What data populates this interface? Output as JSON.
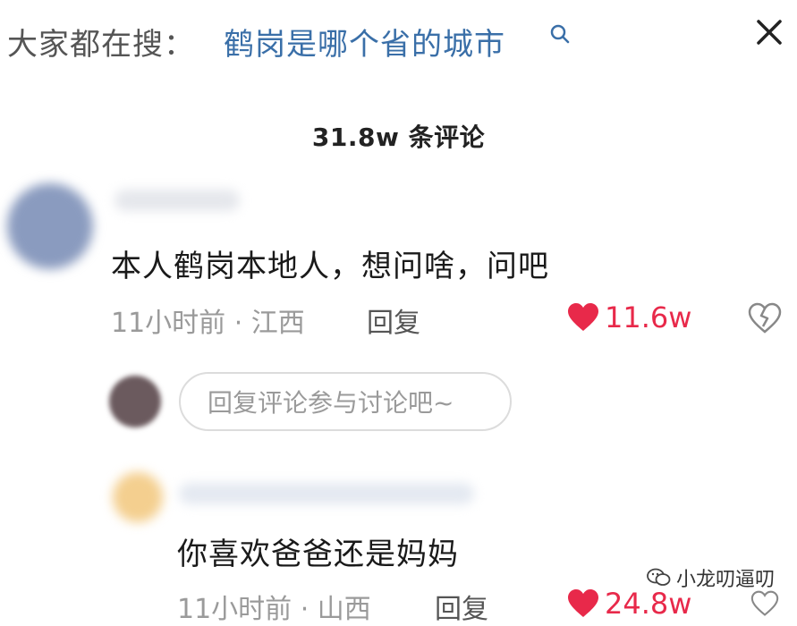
{
  "header": {
    "search_prefix": "大家都在搜：",
    "search_query": "鹤岗是哪个省的城市",
    "search_icon": "search-icon",
    "close_icon": "close-icon"
  },
  "comments_count_title": "31.8w 条评论",
  "comments": [
    {
      "text": "本人鹤岗本地人，想问啥，问吧",
      "meta": "11小时前 · 江西",
      "reply_label": "回复",
      "like_count": "11.6w"
    },
    {
      "text": "你喜欢爸爸还是妈妈",
      "meta": "11小时前 · 山西",
      "reply_label": "回复",
      "like_count": "24.8w"
    }
  ],
  "reply_input": {
    "placeholder": "回复评论参与讨论吧~"
  },
  "watermark": {
    "text": "小龙叨逼叨"
  },
  "colors": {
    "accent_link": "#3a6fa8",
    "like_red": "#e8294a",
    "meta_gray": "#9a9a9a"
  }
}
